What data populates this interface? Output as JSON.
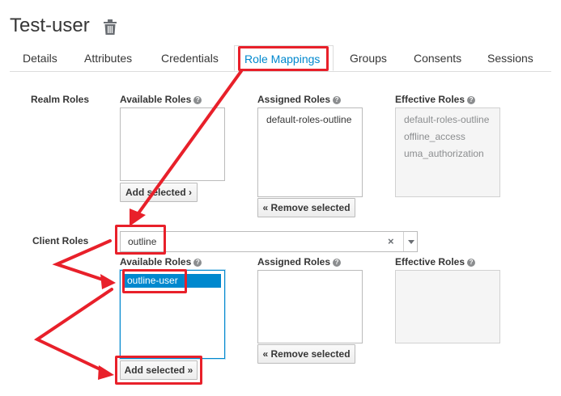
{
  "page": {
    "title": "Test-user"
  },
  "tabs": [
    "Details",
    "Attributes",
    "Credentials",
    "Role Mappings",
    "Groups",
    "Consents",
    "Sessions"
  ],
  "realm_roles": {
    "label": "Realm Roles",
    "available_label": "Available Roles",
    "assigned_label": "Assigned Roles",
    "effective_label": "Effective Roles",
    "assigned": [
      "default-roles-outline"
    ],
    "effective": [
      "default-roles-outline",
      "offline_access",
      "uma_authorization"
    ],
    "add_button": "Add selected ›",
    "remove_button": "« Remove selected"
  },
  "client_roles": {
    "label": "Client Roles",
    "client_value": "outline",
    "available_label": "Available Roles",
    "assigned_label": "Assigned Roles",
    "effective_label": "Effective Roles",
    "available": [
      "outline-user"
    ],
    "add_button": "Add selected »",
    "remove_button": "« Remove selected"
  },
  "icons": {
    "delete": "trash-icon",
    "help": "help-circle-icon",
    "clear": "clear-icon",
    "dropdown": "caret-down-icon"
  },
  "colors": {
    "accent": "#0088ce",
    "annotation": "#e8202a"
  }
}
